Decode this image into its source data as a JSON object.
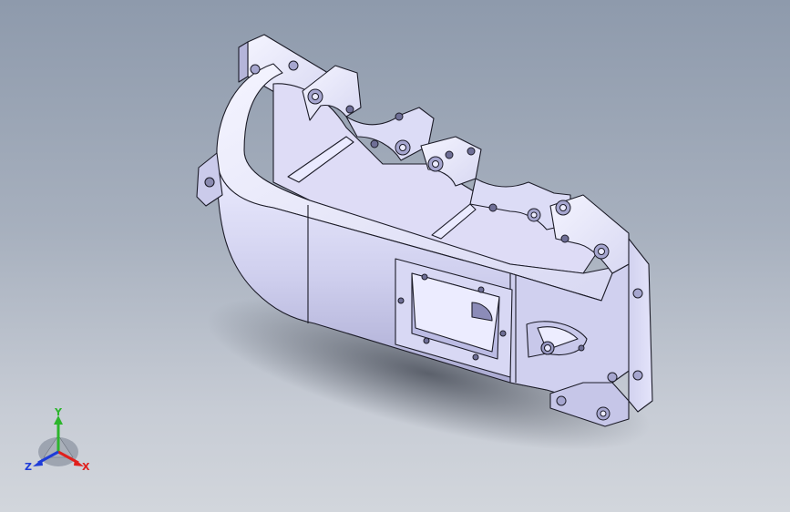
{
  "viewport": {
    "background_top": "#8e9aac",
    "background_bottom": "#d2d6dc",
    "part_color": "#d3d3ef",
    "edge_color": "#1c1c28"
  },
  "triad": {
    "x_label": "X",
    "y_label": "Y",
    "z_label": "Z",
    "x_color": "#e0201c",
    "y_color": "#2cb52c",
    "z_color": "#1e3cd8"
  }
}
